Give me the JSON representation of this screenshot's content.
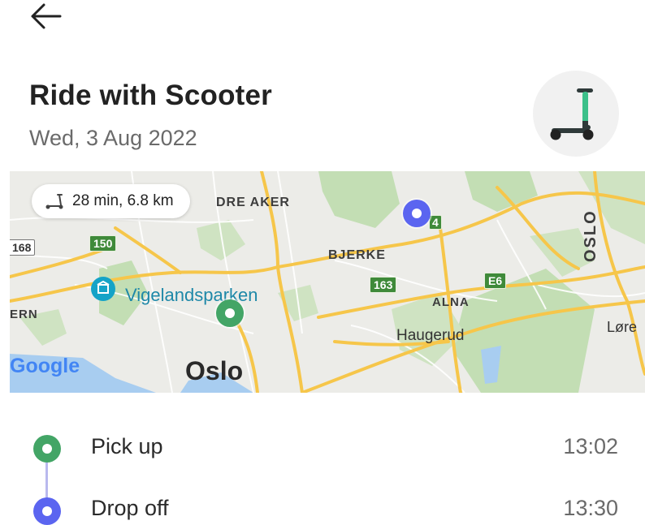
{
  "header": {
    "back_icon": "arrow-left-icon"
  },
  "trip": {
    "title": "Ride with Scooter",
    "date": "Wed, 3 Aug 2022",
    "vehicle_icon": "scooter-icon"
  },
  "map": {
    "summary": "28 min, 6.8 km",
    "summary_icon": "scooter-icon",
    "labels": {
      "nordre_aker": "DRE AKER",
      "bjerke": "BJERKE",
      "alna": "ALNA",
      "haugerud": "Haugerud",
      "oslo_city": "Oslo",
      "oslo_vertical": "OSLO",
      "vigelandsparken": "Vigelandsparken",
      "ern": "ERN",
      "lore": "Løre",
      "google": "Google"
    },
    "shields": {
      "r168": "168",
      "r150": "150",
      "r163": "163",
      "e6": "E6",
      "r4": "4"
    },
    "colors": {
      "pickup": "#43a566",
      "dropoff": "#5b65f0",
      "road": "#f6c64a",
      "park": "#c3deb4",
      "water": "#a8cdf0"
    }
  },
  "stops": [
    {
      "label": "Pick up",
      "time": "13:02",
      "color": "#43a566"
    },
    {
      "label": "Drop off",
      "time": "13:30",
      "color": "#5b65f0"
    }
  ]
}
